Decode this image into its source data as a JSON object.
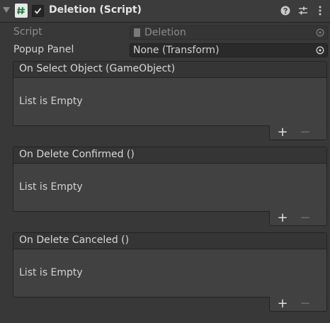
{
  "component": {
    "title": "Deletion (Script)",
    "enabled": true
  },
  "fields": {
    "script": {
      "label": "Script",
      "value": "Deletion"
    },
    "popup_panel": {
      "label": "Popup Panel",
      "value": "None (Transform)"
    }
  },
  "events": [
    {
      "title": "On Select Object (GameObject)",
      "empty_text": "List is Empty"
    },
    {
      "title": "On Delete Confirmed ()",
      "empty_text": "List is Empty"
    },
    {
      "title": "On Delete Canceled ()",
      "empty_text": "List is Empty"
    }
  ],
  "list_buttons": {
    "add": "+",
    "remove": "−"
  },
  "icons": {
    "foldout": "foldout-arrow-icon",
    "script": "csharp-script-icon",
    "help": "help-icon",
    "presets": "presets-icon",
    "menu": "kebab-menu-icon",
    "picker": "object-picker-icon"
  }
}
